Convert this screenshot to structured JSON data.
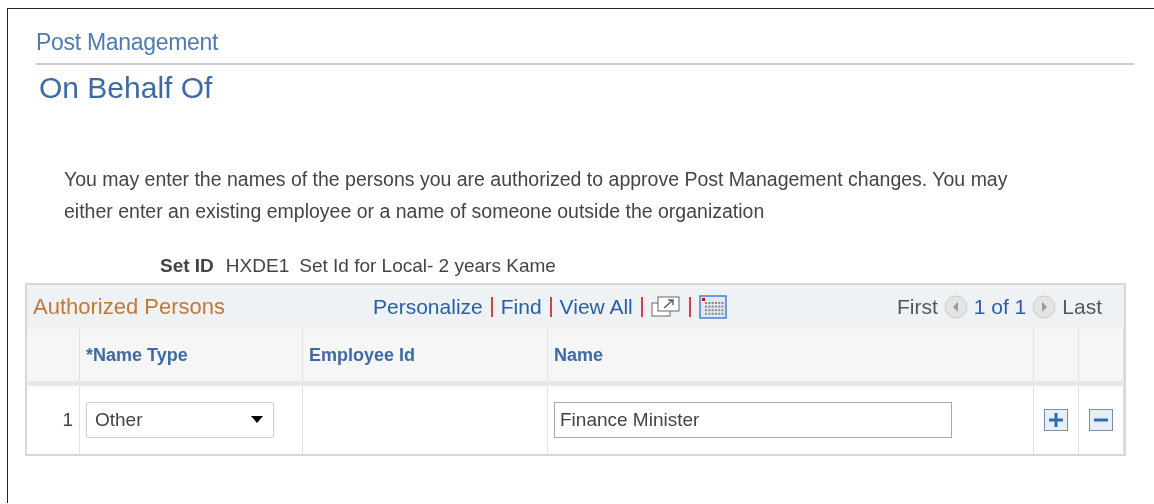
{
  "page": {
    "breadcrumb": "Post Management",
    "title": "On Behalf Of",
    "instructions": "You may enter the names of the persons you are authorized to approve Post Management changes. You may either enter an existing employee or a name of someone outside the organization"
  },
  "set_id": {
    "label": "Set ID",
    "code": "HXDE1",
    "description": "Set Id for Local- 2 years Kame"
  },
  "grid": {
    "title": "Authorized Persons",
    "links": [
      {
        "label": "Personalize"
      },
      {
        "label": "Find"
      },
      {
        "label": "View All"
      }
    ],
    "pager": {
      "first": "First",
      "count": "1 of 1",
      "last": "Last"
    },
    "columns": [
      "*Name Type",
      "Employee Id",
      "Name"
    ],
    "rows": [
      {
        "number": "1",
        "name_type": "Other",
        "employee_id": "",
        "name": "Finance Minister"
      }
    ]
  }
}
